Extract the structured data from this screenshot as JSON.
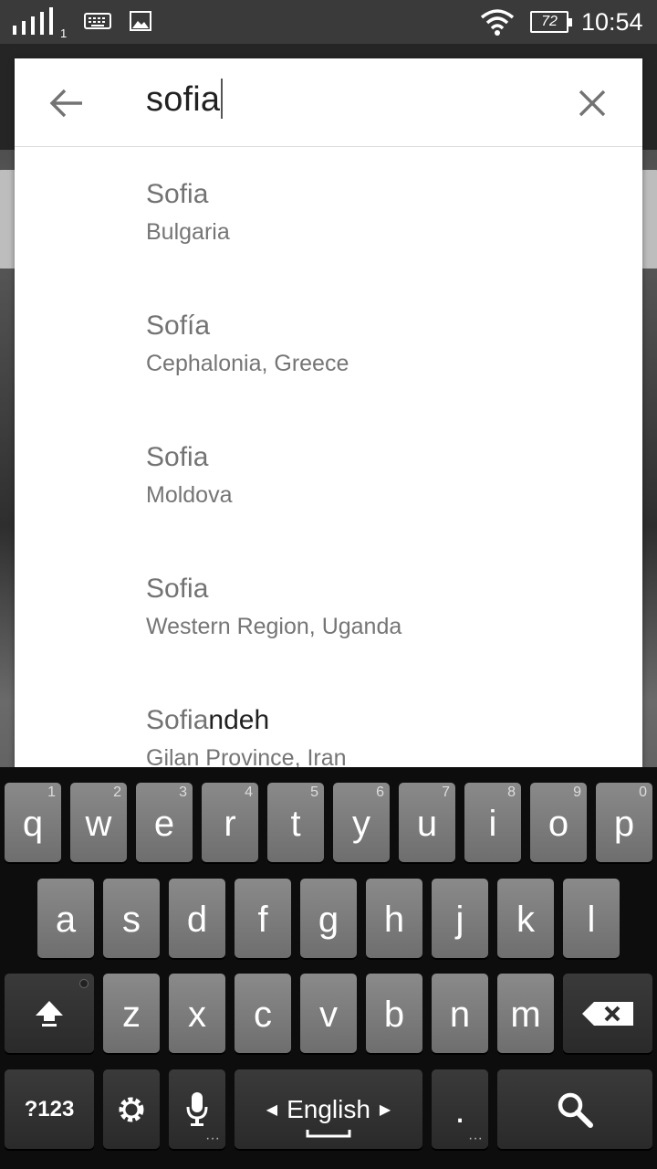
{
  "status_bar": {
    "sim_number": "1",
    "battery_level": "72",
    "time": "10:54",
    "icons": [
      "signal-icon",
      "keyboard-icon",
      "image-icon",
      "wifi-icon",
      "battery-icon"
    ]
  },
  "search": {
    "query": "sofia",
    "back_icon": "arrow-back-icon",
    "clear_icon": "close-icon"
  },
  "results": [
    {
      "match": "Sofia",
      "rest": "",
      "subtitle": "Bulgaria"
    },
    {
      "match": "Sofía",
      "rest": "",
      "subtitle": "Cephalonia, Greece"
    },
    {
      "match": "Sofia",
      "rest": "",
      "subtitle": "Moldova"
    },
    {
      "match": "Sofia",
      "rest": "",
      "subtitle": "Western Region, Uganda"
    },
    {
      "match": "Sofia",
      "rest": "ndeh",
      "subtitle": "Gilan Province, Iran"
    }
  ],
  "keyboard": {
    "row1": [
      {
        "key": "q",
        "hint": "1"
      },
      {
        "key": "w",
        "hint": "2"
      },
      {
        "key": "e",
        "hint": "3"
      },
      {
        "key": "r",
        "hint": "4"
      },
      {
        "key": "t",
        "hint": "5"
      },
      {
        "key": "y",
        "hint": "6"
      },
      {
        "key": "u",
        "hint": "7"
      },
      {
        "key": "i",
        "hint": "8"
      },
      {
        "key": "o",
        "hint": "9"
      },
      {
        "key": "p",
        "hint": "0"
      }
    ],
    "row2": [
      "a",
      "s",
      "d",
      "f",
      "g",
      "h",
      "j",
      "k",
      "l"
    ],
    "row3": [
      "z",
      "x",
      "c",
      "v",
      "b",
      "n",
      "m"
    ],
    "symbols_label": "?123",
    "language_label": "English",
    "period_label": "."
  }
}
